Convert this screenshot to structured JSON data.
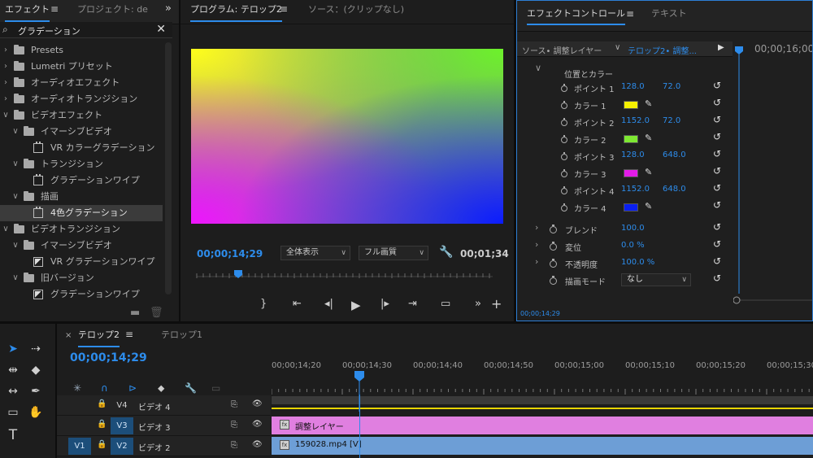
{
  "effects_panel": {
    "tabs": [
      "エフェクト",
      "プロジェクト: de"
    ],
    "search_value": "グラデーション",
    "items": [
      {
        "label": "Presets",
        "level": 0,
        "kind": "folder-star"
      },
      {
        "label": "Lumetri プリセット",
        "level": 0,
        "kind": "folder-star"
      },
      {
        "label": "オーディオエフェクト",
        "level": 0,
        "kind": "folder"
      },
      {
        "label": "オーディオトランジション",
        "level": 0,
        "kind": "folder"
      },
      {
        "label": "ビデオエフェクト",
        "level": 0,
        "kind": "folder",
        "open": true
      },
      {
        "label": "イマーシブビデオ",
        "level": 1,
        "kind": "folder",
        "open": true
      },
      {
        "label": "VR カラーグラデーション",
        "level": 2,
        "kind": "effect"
      },
      {
        "label": "トランジション",
        "level": 1,
        "kind": "folder",
        "open": true
      },
      {
        "label": "グラデーションワイプ",
        "level": 2,
        "kind": "effect"
      },
      {
        "label": "描画",
        "level": 1,
        "kind": "folder",
        "open": true
      },
      {
        "label": "4色グラデーション",
        "level": 2,
        "kind": "effect",
        "selected": true
      },
      {
        "label": "ビデオトランジション",
        "level": 0,
        "kind": "folder",
        "open": true
      },
      {
        "label": "イマーシブビデオ",
        "level": 1,
        "kind": "folder",
        "open": true
      },
      {
        "label": "VR グラデーションワイプ",
        "level": 2,
        "kind": "transition"
      },
      {
        "label": "旧バージョン",
        "level": 1,
        "kind": "folder",
        "open": true
      },
      {
        "label": "グラデーションワイプ",
        "level": 2,
        "kind": "transition"
      }
    ]
  },
  "program_monitor": {
    "tabs": [
      "プログラム: テロップ2",
      "ソース：(クリップなし)"
    ],
    "timecode": "00;00;14;29",
    "zoom": "全体表示",
    "quality": "フル画質",
    "duration": "00;01;34"
  },
  "effect_controls": {
    "tabs": [
      "エフェクトコントロール",
      "テキスト"
    ],
    "source_label": "ソース• 調整レイヤー",
    "sequence_label": "テロップ2• 調整...",
    "panel_timecode": "00;00;16;00",
    "group_label": "位置とカラー",
    "rows": [
      {
        "name": "ポイント 1",
        "v1": "128.0",
        "v2": "72.0"
      },
      {
        "name": "カラー 1",
        "color": "#f5f000"
      },
      {
        "name": "ポイント 2",
        "v1": "1152.0",
        "v2": "72.0"
      },
      {
        "name": "カラー 2",
        "color": "#7ee832"
      },
      {
        "name": "ポイント 3",
        "v1": "128.0",
        "v2": "648.0"
      },
      {
        "name": "カラー 3",
        "color": "#e21be8"
      },
      {
        "name": "ポイント 4",
        "v1": "1152.0",
        "v2": "648.0"
      },
      {
        "name": "カラー 4",
        "color": "#0a1ff0"
      }
    ],
    "blend": {
      "label": "ブレンド",
      "value": "100.0"
    },
    "jitter": {
      "label": "変位",
      "value": "0.0 %"
    },
    "opacity": {
      "label": "不透明度",
      "value": "100.0 %"
    },
    "blend_mode": {
      "label": "描画モード",
      "value": "なし"
    },
    "footer_timecode": "00;00;14;29"
  },
  "timeline": {
    "tabs": [
      "テロップ2",
      "テロップ1"
    ],
    "timecode": "00;00;14;29",
    "ruler_ticks": [
      "00;00;14;20",
      "00;00;14;30",
      "00;00;14;40",
      "00;00;14;50",
      "00;00;15;00",
      "00;00;15;10",
      "00;00;15;20",
      "00;00;15;30"
    ],
    "tracks": [
      {
        "id": "V4",
        "name": "ビデオ 4",
        "source": ""
      },
      {
        "id": "V3",
        "name": "ビデオ 3",
        "source": ""
      },
      {
        "id": "V2",
        "name": "ビデオ 2",
        "source": "V1"
      }
    ],
    "clips": [
      {
        "track": "V3",
        "label": "調整レイヤー",
        "color": "#e07fe0"
      },
      {
        "track": "V2",
        "label": "159028.mp4 [V]",
        "color": "#6d9ed6"
      }
    ]
  }
}
